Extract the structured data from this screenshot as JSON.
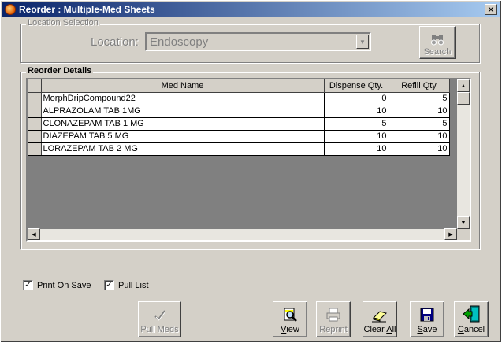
{
  "window": {
    "title": "Reorder : Multiple-Med Sheets",
    "close_glyph": "✕"
  },
  "location_group": {
    "legend": "Location Selection",
    "label": "Location:",
    "value": "Endoscopy",
    "search_label": "Search"
  },
  "reorder_group": {
    "legend": "Reorder Details",
    "columns": [
      "Med Name",
      "Dispense Qty.",
      "Refill Qty"
    ],
    "rows": [
      {
        "name": "MorphDripCompound22",
        "dispense": "0",
        "refill": "5"
      },
      {
        "name": "ALPRAZOLAM TAB 1MG",
        "dispense": "10",
        "refill": "10"
      },
      {
        "name": "CLONAZEPAM TAB 1 MG",
        "dispense": "5",
        "refill": "5"
      },
      {
        "name": "DIAZEPAM TAB  5 MG",
        "dispense": "10",
        "refill": "10"
      },
      {
        "name": "LORAZEPAM TAB 2 MG",
        "dispense": "10",
        "refill": "10"
      }
    ]
  },
  "options": {
    "print_on_save": {
      "label": "Print On Save",
      "checked": true
    },
    "pull_list": {
      "label": "Pull List",
      "checked": true
    },
    "check_glyph": "✓"
  },
  "buttons": {
    "pull_meds": "Pull Meds",
    "view": "View",
    "reprint": "Reprint",
    "clear_all": "Clear All",
    "save": "Save",
    "cancel": "Cancel"
  },
  "icons": {
    "search": "binoculars-icon",
    "pull_meds": "checkmark-icon",
    "view": "magnifier-document-icon",
    "reprint": "printer-icon",
    "clear_all": "eraser-icon",
    "save": "floppy-disk-icon",
    "cancel": "exit-door-icon"
  }
}
